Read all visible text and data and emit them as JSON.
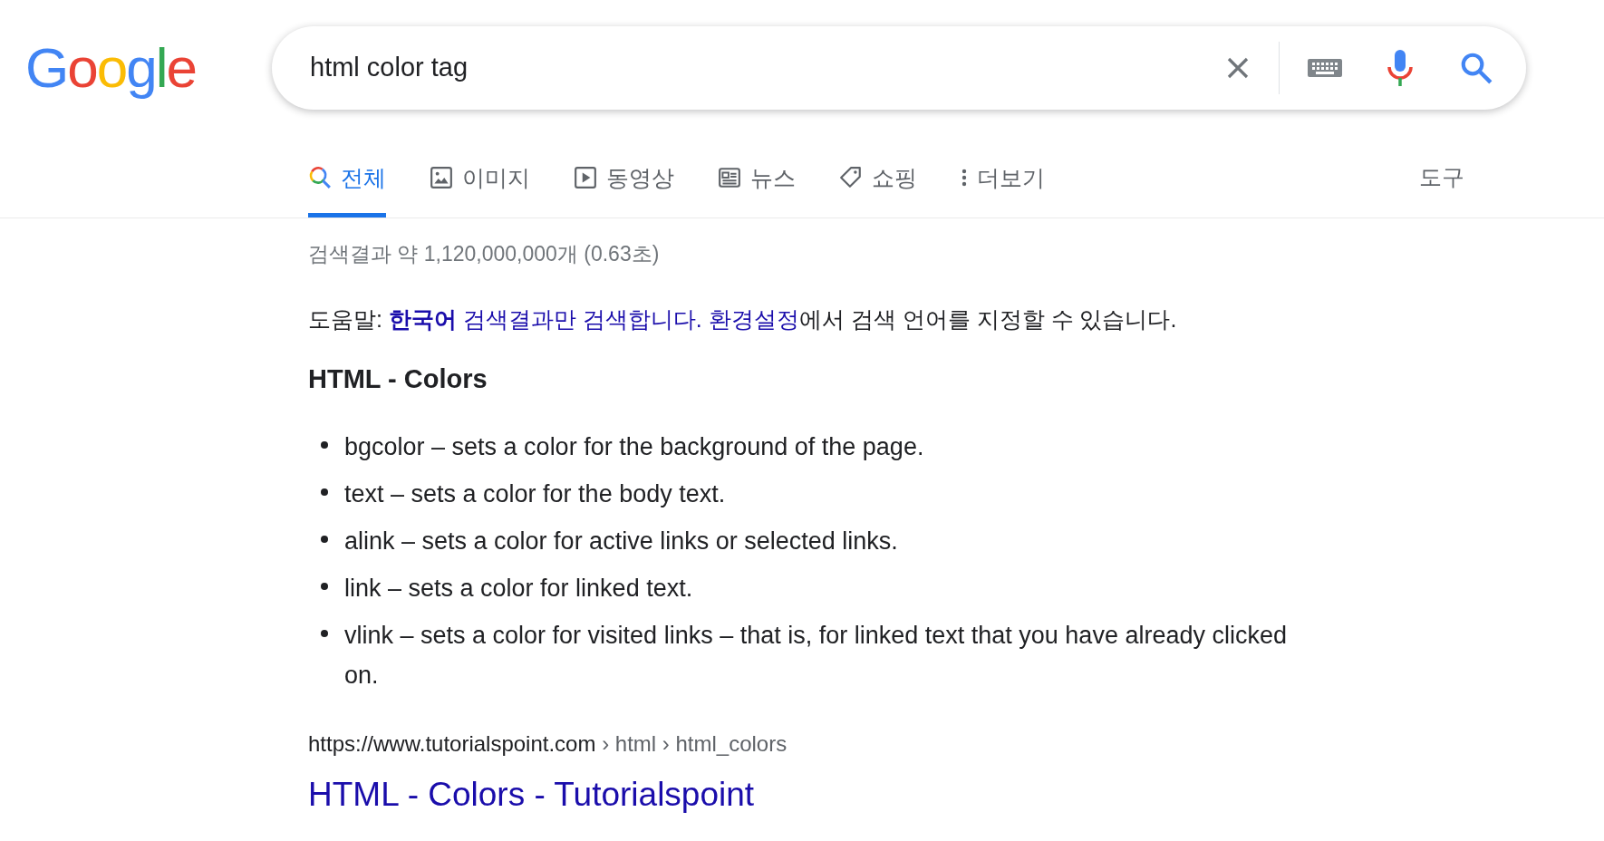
{
  "logo": "Google",
  "search": {
    "value": "html color tag"
  },
  "tabs": [
    {
      "label": "전체",
      "selected": true
    },
    {
      "label": "이미지",
      "selected": false
    },
    {
      "label": "동영상",
      "selected": false
    },
    {
      "label": "뉴스",
      "selected": false
    },
    {
      "label": "쇼핑",
      "selected": false
    },
    {
      "label": "더보기",
      "selected": false
    }
  ],
  "tools": "도구",
  "result_stats": "검색결과 약 1,120,000,000개 (0.63초)",
  "help": [
    {
      "kind": "text",
      "text": "도움말: "
    },
    {
      "kind": "link",
      "text": "**한국어** 검색결과만 검색합니다."
    },
    {
      "kind": "link",
      "text": "환경설정"
    },
    {
      "kind": "text",
      "text": "에서 검색 언어를 지정할 수 있습니다."
    }
  ],
  "snippet": {
    "heading": "HTML - Colors",
    "items": [
      "bgcolor – sets a color for the background of the page.",
      "text – sets a color for the body text.",
      "alink – sets a color for active links or selected links.",
      "link – sets a color for linked text.",
      "vlink – sets a color for visited links – that is, for linked text that you have already clicked on."
    ]
  },
  "result": {
    "url": "https://www.tutorialspoint.com",
    "breadcrumb": " › html › html_colors",
    "title": "HTML - Colors - Tutorialspoint"
  }
}
